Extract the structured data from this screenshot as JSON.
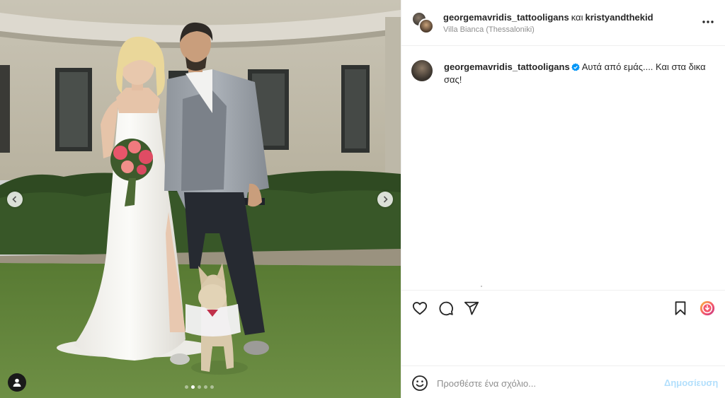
{
  "photo": {
    "carousel_total": 5,
    "carousel_active": 2,
    "icons": {
      "prev": "chevron-left-icon",
      "next": "chevron-right-icon",
      "tags": "user-icon"
    }
  },
  "header": {
    "user1": "georgemavridis_tattooligans",
    "conjunction": "και",
    "user2": "kristyandthekid",
    "location": "Villa Bianca (Thessaloniki)",
    "more_icon": "more-horizontal-icon"
  },
  "caption": {
    "username": "georgemavridis_tattooligans",
    "verified": true,
    "text": "Αυτά από εμάς.... Και στα δικα σας!"
  },
  "actions": {
    "icons": [
      "heart-icon",
      "comment-icon",
      "share-icon",
      "bookmark-icon",
      "extension-icon"
    ]
  },
  "comment": {
    "placeholder": "Προσθέστε ένα σχόλιο...",
    "post_label": "Δημοσίευση"
  },
  "colors": {
    "text": "#262626",
    "secondary": "#8e8e8e",
    "border": "#efefef",
    "verified": "#0095f6",
    "post_disabled": "#b2dffc"
  }
}
